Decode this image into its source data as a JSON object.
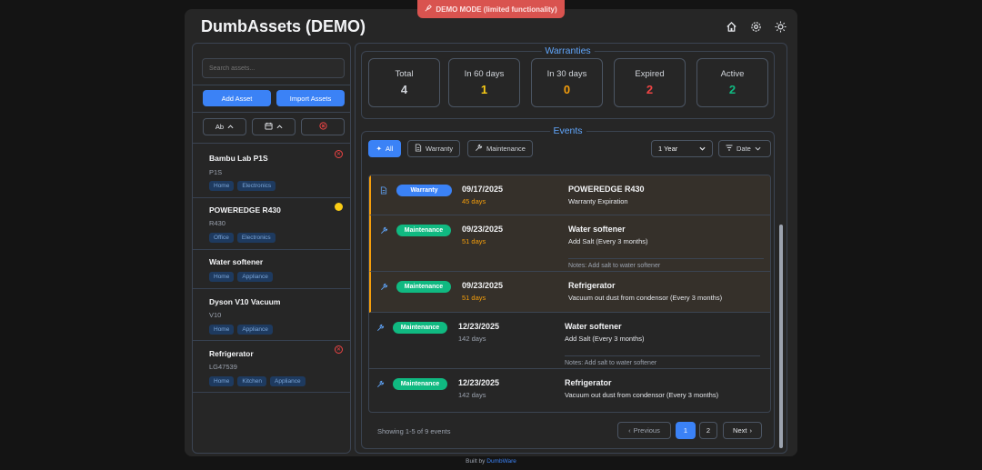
{
  "banner": {
    "icon": "syringe-icon",
    "text": "DEMO MODE (limited functionality)"
  },
  "header": {
    "title": "DumbAssets (DEMO)",
    "icons": [
      "home-icon",
      "gear-icon",
      "sun-icon"
    ]
  },
  "sidebar": {
    "search_placeholder": "Search assets...",
    "add_label": "Add Asset",
    "import_label": "Import Assets",
    "sort_name_label": "Ab",
    "assets": [
      {
        "name": "Bambu Lab P1S",
        "model": "P1S",
        "tags": [
          "Home",
          "Electronics"
        ],
        "status": "red"
      },
      {
        "name": "POWEREDGE R430",
        "model": "R430",
        "tags": [
          "Office",
          "Electronics"
        ],
        "status": "yellow"
      },
      {
        "name": "Water softener",
        "model": "",
        "tags": [
          "Home",
          "Appliance"
        ],
        "status": ""
      },
      {
        "name": "Dyson V10 Vacuum",
        "model": "V10",
        "tags": [
          "Home",
          "Appliance"
        ],
        "status": ""
      },
      {
        "name": "Refrigerator",
        "model": "LG47539",
        "tags": [
          "Home",
          "Kitchen",
          "Appliance"
        ],
        "status": "red"
      }
    ]
  },
  "warranties": {
    "legend": "Warranties",
    "stats": [
      {
        "label": "Total",
        "value": "4",
        "color": "#d1d5db"
      },
      {
        "label": "In 60 days",
        "value": "1",
        "color": "#facc15"
      },
      {
        "label": "In 30 days",
        "value": "0",
        "color": "#f59e0b"
      },
      {
        "label": "Expired",
        "value": "2",
        "color": "#ef4444"
      },
      {
        "label": "Active",
        "value": "2",
        "color": "#10b981"
      }
    ]
  },
  "events": {
    "legend": "Events",
    "filters": {
      "all": "All",
      "warranty": "Warranty",
      "maintenance": "Maintenance"
    },
    "range_select": "1 Year",
    "sort_label": "Date",
    "items": [
      {
        "type": "Warranty",
        "date": "09/17/2025",
        "days": "45 days",
        "title": "POWEREDGE R430",
        "desc": "Warranty Expiration",
        "note": ""
      },
      {
        "type": "Maintenance",
        "date": "09/23/2025",
        "days": "51 days",
        "title": "Water softener",
        "desc": "Add Salt (Every 3 months)",
        "note": "Notes: Add salt to water softener"
      },
      {
        "type": "Maintenance",
        "date": "09/23/2025",
        "days": "51 days",
        "title": "Refrigerator",
        "desc": "Vacuum out dust from condensor (Every 3 months)",
        "note": ""
      },
      {
        "type": "Maintenance",
        "date": "12/23/2025",
        "days": "142 days",
        "title": "Water softener",
        "desc": "Add Salt (Every 3 months)",
        "note": "Notes: Add salt to water softener"
      },
      {
        "type": "Maintenance",
        "date": "12/23/2025",
        "days": "142 days",
        "title": "Refrigerator",
        "desc": "Vacuum out dust from condensor (Every 3 months)",
        "note": ""
      }
    ],
    "showing": "Showing 1-5 of 9 events",
    "pager": {
      "previous": "Previous",
      "page1": "1",
      "page2": "2",
      "next": "Next"
    }
  },
  "footer": {
    "prefix": "Built by",
    "link": "DumbWare"
  }
}
